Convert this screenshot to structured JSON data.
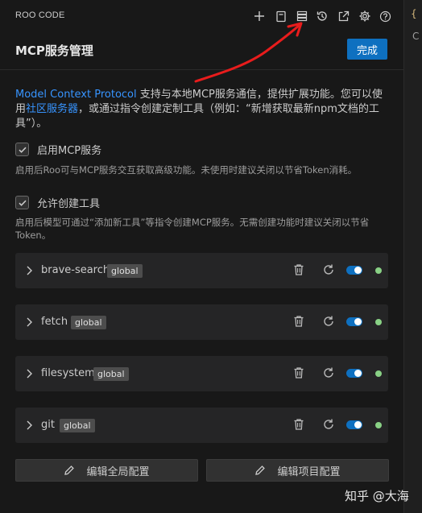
{
  "topbar": {
    "title": "ROO CODE",
    "icons": [
      "plus-icon",
      "notebook-icon",
      "server-icon",
      "history-icon",
      "popout-icon",
      "gear-icon",
      "help-icon"
    ]
  },
  "header": {
    "title": "MCP服务管理",
    "done_label": "完成"
  },
  "description": {
    "link1": "Model Context Protocol",
    "text1": " 支持与本地MCP服务通信，提供扩展功能。您可以使用",
    "link2": "社区服务器",
    "text2": "，或通过指令创建定制工具（例如：“新增获取最新npm文档的工具”）。"
  },
  "settings": {
    "enable_mcp": {
      "label": "启用MCP服务",
      "checked": true,
      "hint": "启用后Roo可与MCP服务交互获取高级功能。未使用时建议关闭以节省Token消耗。"
    },
    "allow_create": {
      "label": "允许创建工具",
      "checked": true,
      "hint": "启用后模型可通过“添加新工具”等指令创建MCP服务。无需创建功能时建议关闭以节省Token。"
    }
  },
  "servers": [
    {
      "name": "brave-search",
      "scope": "global",
      "enabled": true,
      "status_color": "#89d185"
    },
    {
      "name": "fetch",
      "scope": "global",
      "enabled": true,
      "status_color": "#89d185"
    },
    {
      "name": "filesystem",
      "scope": "global",
      "enabled": true,
      "status_color": "#89d185"
    },
    {
      "name": "git",
      "scope": "global",
      "enabled": true,
      "status_color": "#89d185"
    }
  ],
  "actions": {
    "edit_global": "编辑全局配置",
    "edit_project": "编辑项目配置"
  },
  "watermark": "知乎 @大海",
  "colors": {
    "accent": "#0e70c0",
    "link": "#3794ff",
    "status_ok": "#89d185",
    "annotation": "#e81c1c"
  }
}
